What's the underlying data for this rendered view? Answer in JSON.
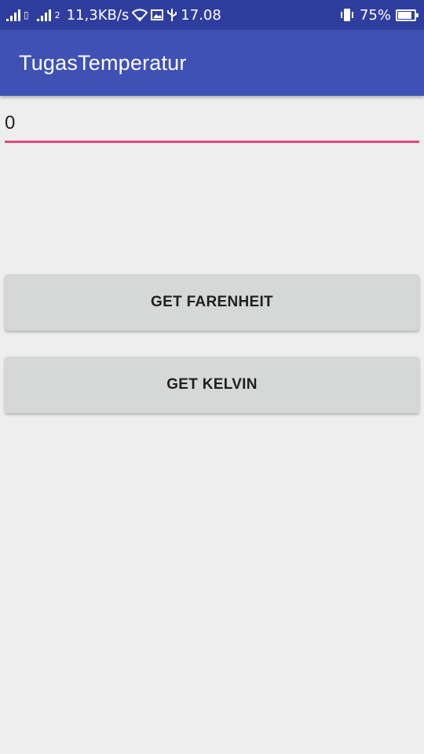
{
  "status_bar": {
    "sim_indicator": "2",
    "net_speed": "11,3KB/s",
    "time": "17.08",
    "battery": "75%",
    "battery_level": 0.75,
    "icons": [
      "signal-icon",
      "wifi-icon",
      "image-icon",
      "usb-icon",
      "vibrate-icon",
      "battery-icon"
    ]
  },
  "app_bar": {
    "title": "TugasTemperatur",
    "color": "#3f51b5"
  },
  "input": {
    "value": "0",
    "underline_color": "#e8467c"
  },
  "buttons": {
    "farenheit_label": "GET FARENHEIT",
    "kelvin_label": "GET KELVIN"
  }
}
